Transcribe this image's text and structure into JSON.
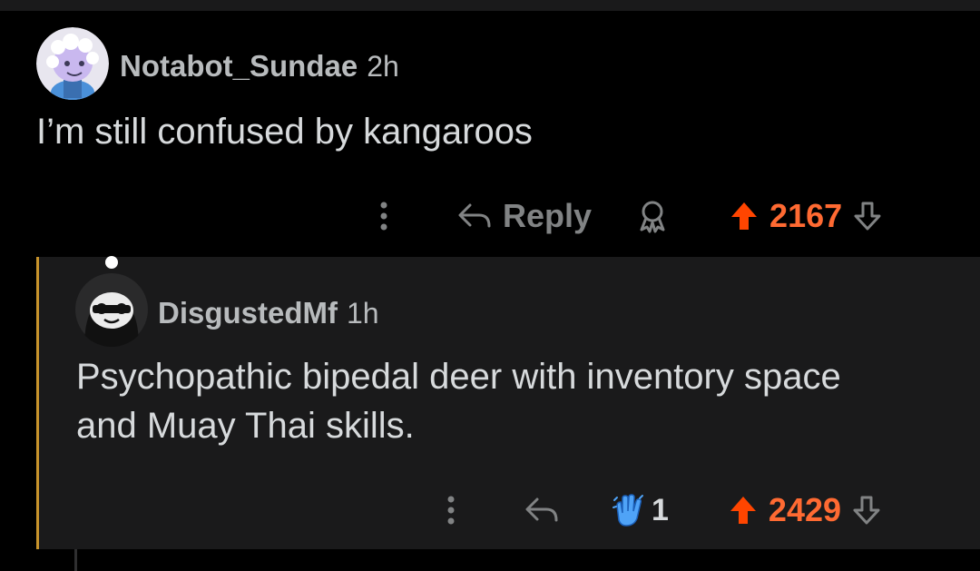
{
  "comments": [
    {
      "username": "Notabot_Sundae",
      "time": "2h",
      "body": "I’m still confused by kangaroos",
      "actions": {
        "more_icon": "more-vertical-icon",
        "reply_label": "Reply",
        "award_icon": "award-icon",
        "score": "2167"
      }
    },
    {
      "username": "DisgustedMf",
      "time": "1h",
      "body": "Psychopathic bipedal deer with inventory space and Muay Thai skills.",
      "actions": {
        "more_icon": "more-vertical-icon",
        "award_icon": "clapping-hands-award-icon",
        "award_count": "1",
        "score": "2429"
      }
    }
  ],
  "colors": {
    "background": "#000000",
    "nested_background": "#1a1a1b",
    "thread_line": "#c7932b",
    "upvote_orange": "#ff4500",
    "score_orange": "#ff6a32",
    "meta_gray": "#818384",
    "text": "#d7dadc"
  }
}
